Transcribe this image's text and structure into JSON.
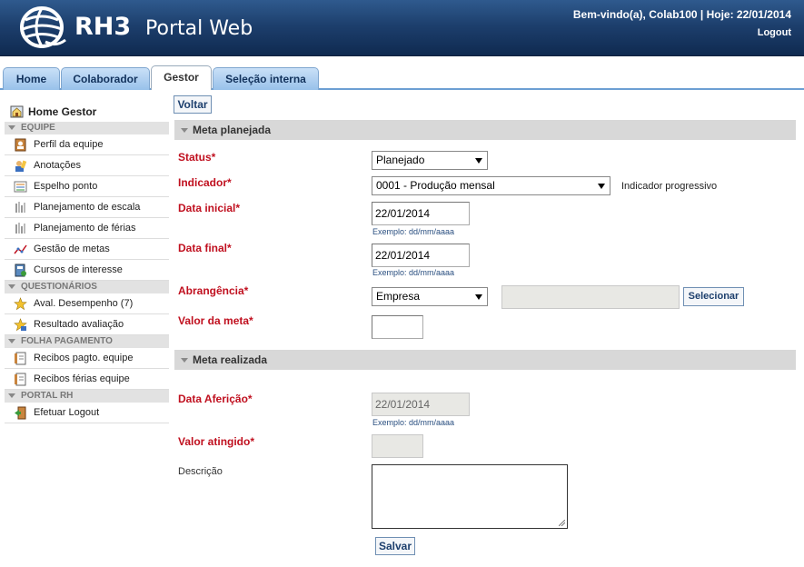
{
  "header": {
    "logo_text": "RH3",
    "logo_subtitle": "Portal Web",
    "welcome": "Bem-vindo(a), Colab100 | Hoje: 22/01/2014",
    "logout": "Logout"
  },
  "tabs": [
    {
      "label": "Home"
    },
    {
      "label": "Colaborador"
    },
    {
      "label": "Gestor",
      "active": true
    },
    {
      "label": "Seleção interna"
    }
  ],
  "sidebar": {
    "home": "Home Gestor",
    "sections": [
      {
        "title": "EQUIPE",
        "items": [
          {
            "label": "Perfil da equipe",
            "icon": "profile-icon"
          },
          {
            "label": "Anotações",
            "icon": "notes-icon"
          },
          {
            "label": "Espelho ponto",
            "icon": "timesheet-icon"
          },
          {
            "label": "Planejamento de escala",
            "icon": "schedule-icon"
          },
          {
            "label": "Planejamento de férias",
            "icon": "vacation-icon"
          },
          {
            "label": "Gestão de metas",
            "icon": "goals-chart-icon"
          },
          {
            "label": "Cursos de interesse",
            "icon": "courses-icon"
          }
        ]
      },
      {
        "title": "QUESTIONÁRIOS",
        "items": [
          {
            "label": "Aval. Desempenho (7)",
            "icon": "star-icon"
          },
          {
            "label": "Resultado avaliação",
            "icon": "star-result-icon"
          }
        ]
      },
      {
        "title": "FOLHA PAGAMENTO",
        "items": [
          {
            "label": "Recibos pagto. equipe",
            "icon": "receipt-icon"
          },
          {
            "label": "Recibos férias equipe",
            "icon": "receipt-vacation-icon"
          }
        ]
      },
      {
        "title": "PORTAL RH",
        "items": [
          {
            "label": "Efetuar Logout",
            "icon": "exit-icon"
          }
        ]
      }
    ]
  },
  "main": {
    "back_button": "Voltar",
    "planned": {
      "title": "Meta planejada",
      "status_label": "Status*",
      "status_value": "Planejado",
      "indicator_label": "Indicador*",
      "indicator_value": "0001 - Produção mensal",
      "indicator_note": "Indicador progressivo",
      "start_label": "Data inicial*",
      "start_value": "22/01/2014",
      "start_hint": "Exemplo: dd/mm/aaaa",
      "end_label": "Data final*",
      "end_value": "22/01/2014",
      "end_hint": "Exemplo: dd/mm/aaaa",
      "scope_label": "Abrangência*",
      "scope_value": "Empresa",
      "scope_detail": "",
      "select_button": "Selecionar",
      "target_label": "Valor da meta*",
      "target_value": ""
    },
    "achieved": {
      "title": "Meta realizada",
      "date_label": "Data Aferição*",
      "date_value": "22/01/2014",
      "date_hint": "Exemplo: dd/mm/aaaa",
      "value_label": "Valor atingido*",
      "value_value": "",
      "description_label": "Descrição",
      "description_value": "",
      "save_button": "Salvar"
    }
  },
  "colors": {
    "header_bg": "#1d3f6d",
    "required_label": "#c0101f",
    "tab_bg": "#98c1ea",
    "section_bg": "#d8d8d8"
  }
}
